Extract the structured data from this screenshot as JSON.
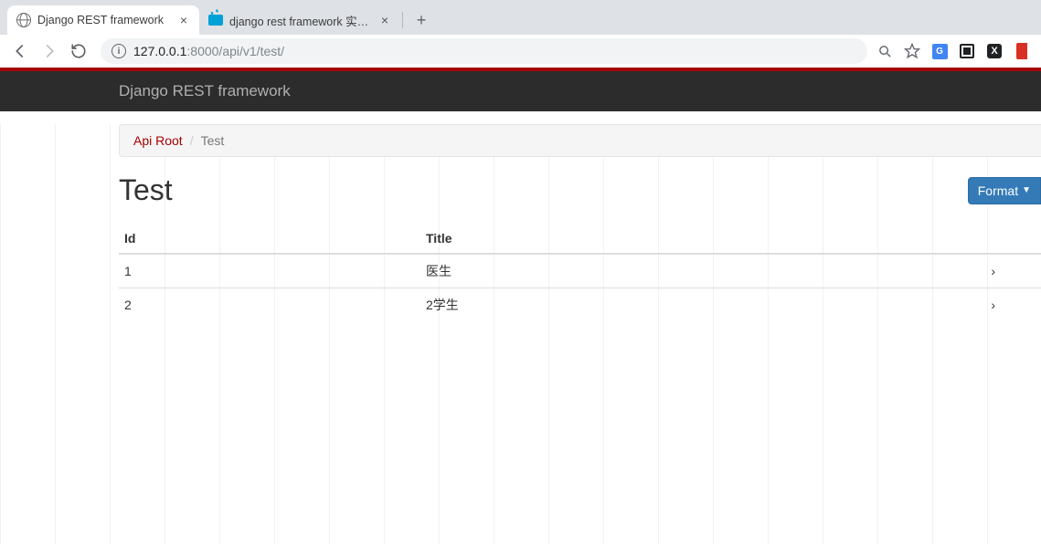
{
  "browser": {
    "tabs": [
      {
        "title": "Django REST framework",
        "favicon": "globe",
        "active": true
      },
      {
        "title": "django rest framework 实战和…",
        "favicon": "bili",
        "active": false
      }
    ],
    "url_host": "127.0.0.1",
    "url_port_path": ":8000/api/v1/test/"
  },
  "navbar": {
    "brand": "Django REST framework"
  },
  "breadcrumb": {
    "root_label": "Api Root",
    "sep": "/",
    "current": "Test"
  },
  "page": {
    "title": "Test",
    "format_button": "Format"
  },
  "table": {
    "headers": {
      "id": "Id",
      "title": "Title"
    },
    "rows": [
      {
        "id": "1",
        "title": "医生"
      },
      {
        "id": "2",
        "title": "2学生"
      }
    ]
  }
}
